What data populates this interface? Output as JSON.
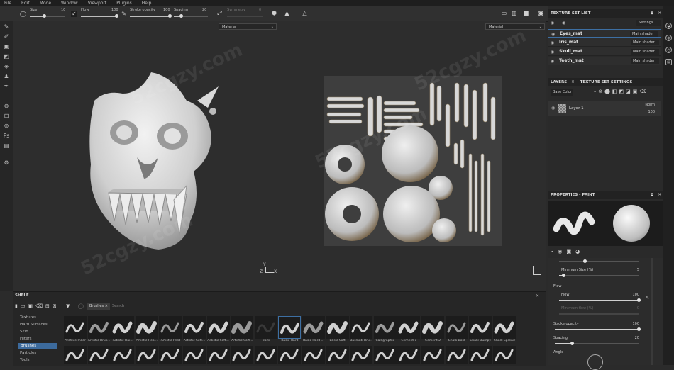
{
  "menu": [
    "File",
    "Edit",
    "Mode",
    "Window",
    "Viewport",
    "Plugins",
    "Help"
  ],
  "toolbar": {
    "size_label": "Size",
    "size_value": "10",
    "flow_label": "Flow",
    "flow_value": "100",
    "stroke_opacity_label": "Stroke opacity",
    "stroke_opacity_value": "100",
    "spacing_label": "Spacing",
    "spacing_value": "20",
    "symmetry_label": "Symmetry",
    "symmetry_value": "0",
    "size_level": 0.4,
    "flow_level": 1.0,
    "stroke_level": 1.0,
    "spacing_level": 0.2
  },
  "viewport": {
    "left_material": "Material",
    "right_material": "Material"
  },
  "texture_set_list": {
    "title": "TEXTURE SET LIST",
    "settings_label": "Settings",
    "rows": [
      {
        "name": "Eyes_mat",
        "shader": "Main shader",
        "selected": true
      },
      {
        "name": "Iris_mat",
        "shader": "Main shader",
        "selected": false
      },
      {
        "name": "Skull_mat",
        "shader": "Main shader",
        "selected": false
      },
      {
        "name": "Teeth_mat",
        "shader": "Main shader",
        "selected": false
      }
    ]
  },
  "layers": {
    "tab_layers": "LAYERS",
    "tab_settings": "TEXTURE SET SETTINGS",
    "channel": "Base Color",
    "layer_name": "Layer 1",
    "blend": "Norm",
    "opacity": "100"
  },
  "properties": {
    "title": "PROPERTIES - PAINT",
    "min_size_label": "Minimum Size (%)",
    "min_size_value": "5",
    "flow_section": "Flow",
    "flow_label": "Flow",
    "flow_value": "100",
    "minflow_label": "Minimum flow (%)",
    "minflow_value": "0",
    "stroke_opacity_label": "Stroke opacity",
    "stroke_opacity_value": "100",
    "spacing_label": "Spacing",
    "spacing_value": "20",
    "angle_label": "Angle",
    "flow_level": 1.0,
    "stroke_level": 1.0,
    "spacing_level": 0.2,
    "min_size_level": 0.05
  },
  "shelf": {
    "title": "SHELF",
    "filter_tag": "Brushes",
    "search_placeholder": "Search",
    "categories": [
      "Textures",
      "Hard Surfaces",
      "Skin",
      "Filters",
      "Brushes",
      "Particles",
      "Tools"
    ],
    "selected_category": "Brushes",
    "brushes": [
      "Archive Inker",
      "Artistic Brus...",
      "Artistic Hai...",
      "Artistic Hea...",
      "Artistic Print",
      "Artistic Soft...",
      "Artistic Soft...",
      "Artistic Soft...",
      "Bark",
      "Basic Hard",
      "Basic Hard ...",
      "Basic Soft",
      "Basmati Bru...",
      "Calligraphic",
      "Cement 1",
      "Cement 2",
      "Chalk Bold",
      "Chalk Bumpy",
      "Chalk Spread"
    ]
  },
  "axis": {
    "y": "Y",
    "z": "Z",
    "x": "X"
  },
  "watermark": "52cgzy.com",
  "colors": {
    "accent": "#3d6fa3",
    "panel_bg": "#2a2a2a",
    "viewport_bg": "#2d2d2d"
  }
}
